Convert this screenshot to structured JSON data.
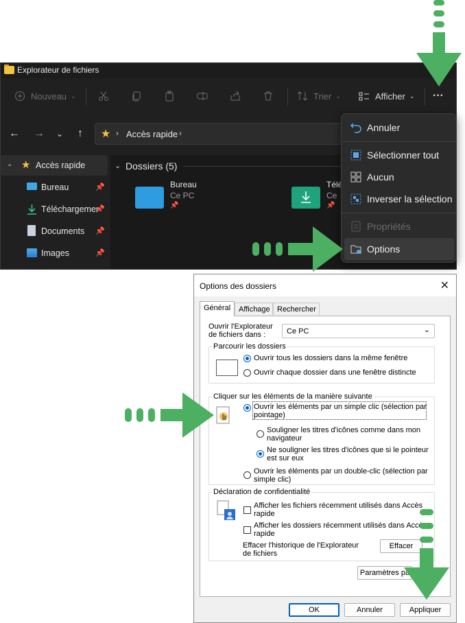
{
  "explorer": {
    "title": "Explorateur de fichiers",
    "cmd": {
      "new": "Nouveau",
      "sort": "Trier",
      "view": "Afficher",
      "more": "···"
    },
    "address": {
      "location": "Accès rapide"
    },
    "sidebar": {
      "header": "Accès rapide",
      "items": [
        {
          "label": "Bureau"
        },
        {
          "label": "Téléchargements"
        },
        {
          "label": "Documents"
        },
        {
          "label": "Images"
        }
      ]
    },
    "section": {
      "title": "Dossiers (5)"
    },
    "folders": [
      {
        "name": "Bureau",
        "location": "Ce PC"
      },
      {
        "name": "Télé",
        "location": "Ce"
      }
    ]
  },
  "menu": {
    "items": [
      {
        "label": "Annuler"
      },
      {
        "label": "Sélectionner tout"
      },
      {
        "label": "Aucun"
      },
      {
        "label": "Inverser la sélection"
      },
      {
        "label": "Propriétés"
      },
      {
        "label": "Options"
      }
    ]
  },
  "dialog": {
    "title": "Options des dossiers",
    "tabs": [
      "Général",
      "Affichage",
      "Rechercher"
    ],
    "open_in": {
      "label_1": "Ouvrir l'Explorateur",
      "label_2": "de fichiers dans :",
      "value": "Ce PC"
    },
    "browse": {
      "caption": "Parcourir les dossiers",
      "opt1": "Ouvrir tous les dossiers dans la même fenêtre",
      "opt2": "Ouvrir chaque dossier dans une fenêtre distincte"
    },
    "click": {
      "caption": "Cliquer sur les éléments de la manière suivante",
      "single_1": "Ouvrir les éléments par un simple clic (sélection par",
      "single_2": "pointage)",
      "underline_1a": "Souligner les titres d'icônes comme dans mon",
      "underline_1b": "navigateur",
      "underline_2a": "Ne souligner les titres d'icônes que si le pointeur",
      "underline_2b": "est sur eux",
      "double_1": "Ouvrir les éléments par un double-clic (sélection par",
      "double_2": "simple clic)"
    },
    "privacy": {
      "caption": "Déclaration de confidentialité",
      "chk1a": "Afficher les fichiers récemment utilisés dans Accès",
      "chk1b": "rapide",
      "chk2a": "Afficher les dossiers récemment utilisés dans Accès",
      "chk2b": "rapide",
      "clear_1": "Effacer l'historique de l'Explorateur",
      "clear_2": "de fichiers",
      "clear_btn": "Effacer"
    },
    "defaults_btn": "Paramètres pa",
    "ok": "OK",
    "cancel": "Annuler",
    "apply": "Appliquer"
  },
  "colors": {
    "arrow": "#4caf61",
    "accent": "#005fb8",
    "dark_bg": "#202020"
  }
}
